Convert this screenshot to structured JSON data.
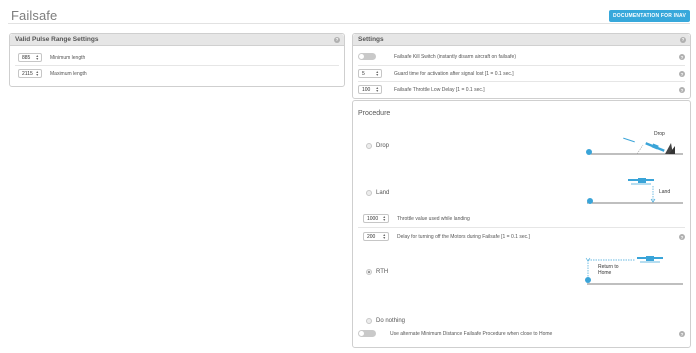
{
  "page": {
    "title": "Failsafe",
    "doc_button": "DOCUMENTATION FOR INAV"
  },
  "pulse_panel": {
    "title": "Valid Pulse Range Settings",
    "rows": [
      {
        "value": "885",
        "label": "Minimum length"
      },
      {
        "value": "2115",
        "label": "Maximum length"
      }
    ]
  },
  "settings_panel": {
    "title": "Settings",
    "kill_switch_label": "Failsafe Kill Switch (instantly disarm aircraft on failsafe)",
    "guard_time": {
      "value": "5",
      "label": "Guard time for activation after signal lost [1 = 0.1 sec.]"
    },
    "throttle_low_delay": {
      "value": "100",
      "label": "Failsafe Throttle Low Delay [1 = 0.1 sec.]"
    }
  },
  "procedure": {
    "heading": "Procedure",
    "options": {
      "drop": "Drop",
      "land": "Land",
      "rth": "RTH",
      "do_nothing": "Do nothing"
    },
    "selected": "rth",
    "drop_diagram_label": "Drop",
    "land_diagram_label": "Land",
    "rth_diagram_label_1": "Return to",
    "rth_diagram_label_2": "Home",
    "throttle_landing": {
      "value": "1000",
      "label": "Throttle value used while landing"
    },
    "motor_off_delay": {
      "value": "200",
      "label": "Delay for turning off the Motors during Failsafe [1 = 0.1 sec.]"
    },
    "min_distance_label": "Use alternate Minimum Distance Failsafe Procedure when close to Home"
  },
  "icons": {
    "help": "help-icon",
    "home": "home-marker-icon",
    "quad": "quadcopter-icon"
  },
  "colors": {
    "accent": "#37a8db",
    "panel_header": "#e6e6e6",
    "toggle_off": "#c9c9c9",
    "diagram_blue": "#3aa4d8"
  }
}
